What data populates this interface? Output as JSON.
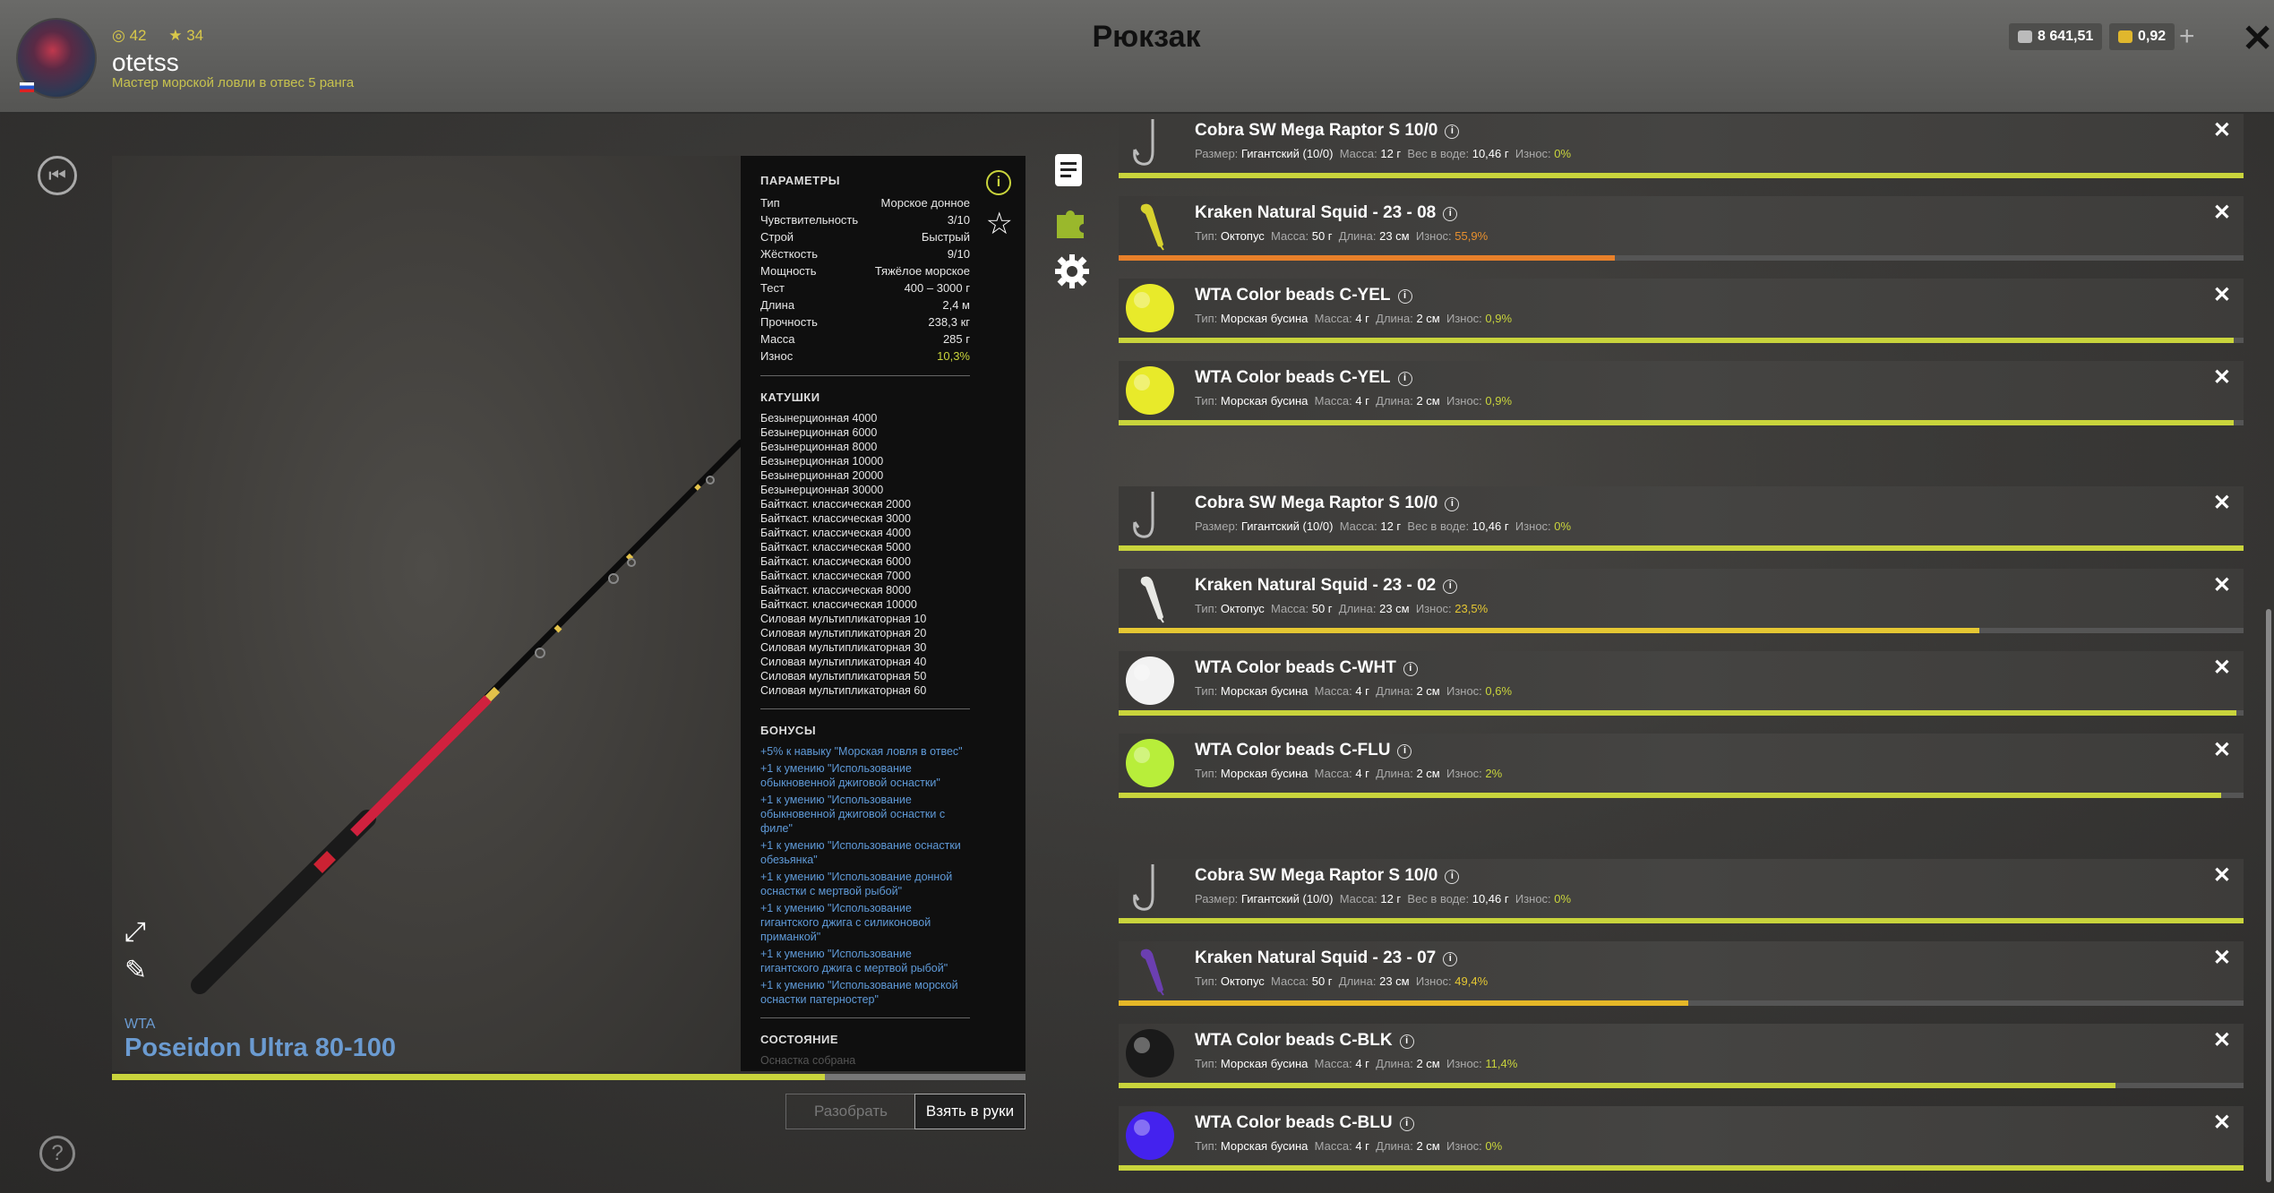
{
  "header": {
    "title": "Рюкзак",
    "username": "otetss",
    "level": "42",
    "stars": "34",
    "rank": "Мастер морской ловли в отвес 5 ранга",
    "silver": "8 641,51",
    "gold": "0,92",
    "plus": "+",
    "close": "✕"
  },
  "rod": {
    "brand": "WTA",
    "name": "Poseidon Ultra 80-100",
    "wear_fraction": 0.78
  },
  "params": {
    "section_title": "ПАРАМЕТРЫ",
    "rows": [
      {
        "k": "Тип",
        "v": "Морское донное"
      },
      {
        "k": "Чувствительность",
        "v": "3/10"
      },
      {
        "k": "Строй",
        "v": "Быстрый"
      },
      {
        "k": "Жёсткость",
        "v": "9/10"
      },
      {
        "k": "Мощность",
        "v": "Тяжёлое морское"
      },
      {
        "k": "Тест",
        "v": "400 – 3000 г"
      },
      {
        "k": "Длина",
        "v": "2,4 м"
      },
      {
        "k": "Прочность",
        "v": "238,3 кг"
      },
      {
        "k": "Масса",
        "v": "285 г"
      },
      {
        "k": "Износ",
        "v": "10,3%"
      }
    ],
    "reels_title": "КАТУШКИ",
    "reels": [
      "Безынерционная 4000",
      "Безынерционная 6000",
      "Безынерционная 8000",
      "Безынерционная 10000",
      "Безынерционная 20000",
      "Безынерционная 30000",
      "Байткаст. классическая 2000",
      "Байткаст. классическая 3000",
      "Байткаст. классическая 4000",
      "Байткаст. классическая 5000",
      "Байткаст. классическая 6000",
      "Байткаст. классическая 7000",
      "Байткаст. классическая 8000",
      "Байткаст. классическая 10000",
      "Силовая мультипликаторная 10",
      "Силовая мультипликаторная 20",
      "Силовая мультипликаторная 30",
      "Силовая мультипликаторная 40",
      "Силовая мультипликаторная 50",
      "Силовая мультипликаторная 60"
    ],
    "bonuses_title": "БОНУСЫ",
    "bonuses": [
      "+5% к навыку \"Морская ловля в отвес\"",
      "+1 к умению \"Использование обыкновенной джиговой оснастки\"",
      "+1 к умению \"Использование обыкновенной джиговой оснастки с филе\"",
      "+1 к умению \"Использование оснастки обезьянка\"",
      "+1 к умению \"Использование донной оснастки с мертвой рыбой\"",
      "+1 к умению \"Использование гигантского джига с силиконовой приманкой\"",
      "+1 к умению \"Использование гигантского джига с мертвой рыбой\"",
      "+1 к умению \"Использование морской оснастки патерностер\""
    ],
    "state_title": "СОСТОЯНИЕ",
    "state_text": "Оснастка собрана"
  },
  "buttons": {
    "disassemble": "Разобрать",
    "take": "Взять в руки"
  },
  "labels": {
    "type": "Тип:",
    "size": "Размер:",
    "mass": "Масса:",
    "length": "Длина:",
    "wear": "Износ:",
    "water_weight": "Вес в воде:"
  },
  "items": [
    {
      "name": "Cobra SW Mega Raptor S 10/0",
      "kind": "hook",
      "a": "Гигантский (10/0)",
      "mass": "12 г",
      "extra": "10,46 г",
      "wear": "0%",
      "wear_class": "",
      "fill": 1.0,
      "bar_color": "#c9d43c"
    },
    {
      "name": "Kraken Natural Squid - 23 - 08",
      "kind": "squid",
      "squid_color": "#d8d22e",
      "a": "Октопус",
      "mass": "50 г",
      "extra": "23 см",
      "wear": "55,9%",
      "wear_class": "orange",
      "fill": 0.441,
      "bar_color": "#e8802a"
    },
    {
      "name": "WTA Color beads C-YEL",
      "kind": "bead",
      "bead_color": "#e8ea2a",
      "a": "Морская бусина",
      "mass": "4 г",
      "extra": "2 см",
      "wear": "0,9%",
      "wear_class": "",
      "fill": 0.991,
      "bar_color": "#c9d43c"
    },
    {
      "name": "WTA Color beads C-YEL",
      "kind": "bead",
      "bead_color": "#e8ea2a",
      "a": "Морская бусина",
      "mass": "4 г",
      "extra": "2 см",
      "wear": "0,9%",
      "wear_class": "",
      "fill": 0.991,
      "bar_color": "#c9d43c"
    },
    {
      "name": "Cobra SW Mega Raptor S 10/0",
      "kind": "hook",
      "a": "Гигантский (10/0)",
      "mass": "12 г",
      "extra": "10,46 г",
      "wear": "0%",
      "wear_class": "",
      "fill": 1.0,
      "bar_color": "#c9d43c"
    },
    {
      "name": "Kraken Natural Squid - 23 - 02",
      "kind": "squid",
      "squid_color": "#e8e8e4",
      "a": "Октопус",
      "mass": "50 г",
      "extra": "23 см",
      "wear": "23,5%",
      "wear_class": "yellow",
      "fill": 0.765,
      "bar_color": "#e5c733"
    },
    {
      "name": "WTA Color beads C-WHT",
      "kind": "bead",
      "bead_color": "#f2f2f2",
      "a": "Морская бусина",
      "mass": "4 г",
      "extra": "2 см",
      "wear": "0,6%",
      "wear_class": "",
      "fill": 0.994,
      "bar_color": "#c9d43c"
    },
    {
      "name": "WTA Color beads C-FLU",
      "kind": "bead",
      "bead_color": "#b8ee3a",
      "a": "Морская бусина",
      "mass": "4 г",
      "extra": "2 см",
      "wear": "2%",
      "wear_class": "",
      "fill": 0.98,
      "bar_color": "#c9d43c"
    },
    {
      "name": "Cobra SW Mega Raptor S 10/0",
      "kind": "hook",
      "a": "Гигантский (10/0)",
      "mass": "12 г",
      "extra": "10,46 г",
      "wear": "0%",
      "wear_class": "",
      "fill": 1.0,
      "bar_color": "#c9d43c"
    },
    {
      "name": "Kraken Natural Squid - 23 - 07",
      "kind": "squid",
      "squid_color": "#6b3fb0",
      "a": "Октопус",
      "mass": "50 г",
      "extra": "23 см",
      "wear": "49,4%",
      "wear_class": "yellow",
      "fill": 0.506,
      "bar_color": "#e5b828"
    },
    {
      "name": "WTA Color beads C-BLK",
      "kind": "bead",
      "bead_color": "#1a1a1a",
      "a": "Морская бусина",
      "mass": "4 г",
      "extra": "2 см",
      "wear": "11,4%",
      "wear_class": "",
      "fill": 0.886,
      "bar_color": "#c9d43c"
    },
    {
      "name": "WTA Color beads C-BLU",
      "kind": "bead",
      "bead_color": "#4422ee",
      "a": "Морская бусина",
      "mass": "4 г",
      "extra": "2 см",
      "wear": "0%",
      "wear_class": "",
      "fill": 1.0,
      "bar_color": "#c9d43c"
    }
  ]
}
